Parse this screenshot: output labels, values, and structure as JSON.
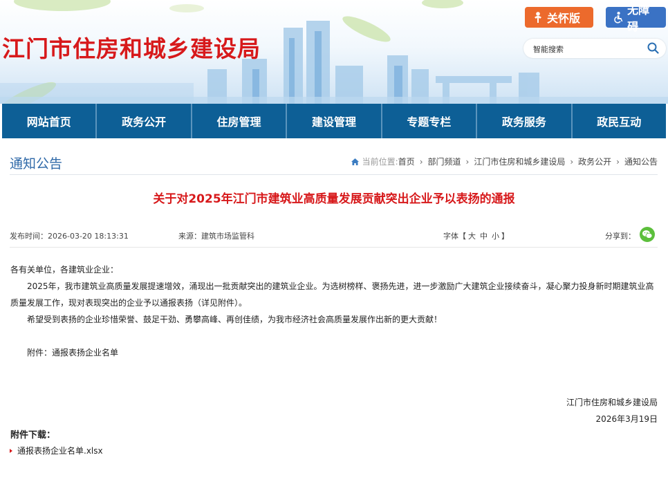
{
  "header": {
    "site_title": "江门市住房和城乡建设局",
    "care_button": "关怀版",
    "accessibility_button": "无障碍",
    "search_placeholder": "智能搜索"
  },
  "nav": {
    "items": [
      "网站首页",
      "政务公开",
      "住房管理",
      "建设管理",
      "专题专栏",
      "政务服务",
      "政民互动"
    ]
  },
  "column": {
    "title": "通知公告",
    "breadcrumb_label": "当前位置:",
    "breadcrumb": [
      "首页",
      "部门频道",
      "江门市住房和城乡建设局",
      "政务公开",
      "通知公告"
    ]
  },
  "article": {
    "title": "关于对2025年江门市建筑业高质量发展贡献突出企业予以表扬的通报",
    "publish_time": "发布时间：2026-03-20 18:13:31",
    "source": "来源：建筑市场监管科",
    "font_label": "字体【",
    "font_sizes": [
      "大",
      "中",
      "小"
    ],
    "font_end": "】",
    "share_label": "分享到：",
    "salutation": "各有关单位，各建筑业企业：",
    "para1": "2025年，我市建筑业高质量发展提速增效，涌现出一批贡献突出的建筑业企业。为选树榜样、褒扬先进，进一步激励广大建筑企业接续奋斗，凝心聚力投身新时期建筑业高质量发展工作，现对表现突出的企业予以通报表扬（详见附件）。",
    "para2": "希望受到表扬的企业珍惜荣誉、鼓足干劲、勇攀高峰、再创佳绩，为我市经济社会高质量发展作出新的更大贡献！",
    "attachment_line": "附件：通报表扬企业名单",
    "signature_org": "江门市住房和城乡建设局",
    "signature_date": "2026年3月19日"
  },
  "attachments": {
    "title": "附件下载：",
    "files": [
      "通报表扬企业名单.xlsx"
    ]
  },
  "colors": {
    "brand_red": "#d7191b",
    "nav_blue": "#0d5f96",
    "care_orange": "#ec6a2c",
    "access_blue": "#3a72c4",
    "wechat_green": "#5cbf3c"
  },
  "icons": [
    "care-icon",
    "accessibility-icon",
    "search-icon",
    "home-icon",
    "wechat-icon"
  ]
}
